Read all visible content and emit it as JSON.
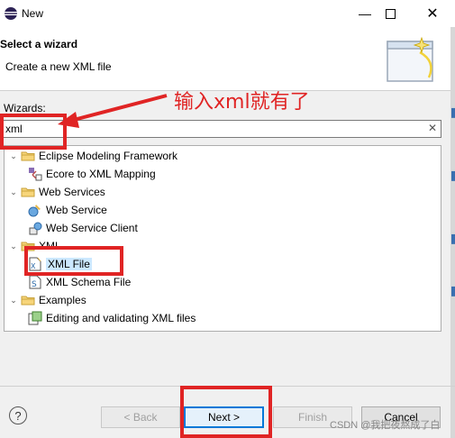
{
  "window": {
    "title": "New"
  },
  "header": {
    "title": "Select a wizard",
    "description": "Create a new XML file"
  },
  "wizards": {
    "label": "Wizards:",
    "filter_value": "xml",
    "tree": [
      {
        "label": "Eclipse Modeling Framework",
        "level": 0,
        "expanded": true,
        "icon": "folder-icon"
      },
      {
        "label": "Ecore to XML Mapping",
        "level": 1,
        "icon": "ecore-mapping-icon"
      },
      {
        "label": "Web Services",
        "level": 0,
        "expanded": true,
        "icon": "folder-icon"
      },
      {
        "label": "Web Service",
        "level": 1,
        "icon": "web-service-icon"
      },
      {
        "label": "Web Service Client",
        "level": 1,
        "icon": "web-service-client-icon"
      },
      {
        "label": "XML",
        "level": 0,
        "expanded": true,
        "icon": "folder-icon"
      },
      {
        "label": "XML File",
        "level": 1,
        "icon": "xml-file-icon",
        "selected": true
      },
      {
        "label": "XML Schema File",
        "level": 1,
        "icon": "xml-schema-icon"
      },
      {
        "label": "Examples",
        "level": 0,
        "expanded": true,
        "icon": "folder-icon"
      },
      {
        "label": "Editing and validating XML files",
        "level": 1,
        "icon": "example-icon"
      }
    ]
  },
  "buttons": {
    "back": "< Back",
    "next": "Next >",
    "finish": "Finish",
    "cancel": "Cancel"
  },
  "annotation": {
    "text": "输入xml就有了"
  },
  "watermark": {
    "text": "CSDN @我把夜熬成了白"
  },
  "colors": {
    "annotation_red": "#e02424",
    "selection": "#cce8ff",
    "default_button_border": "#0078d7"
  }
}
